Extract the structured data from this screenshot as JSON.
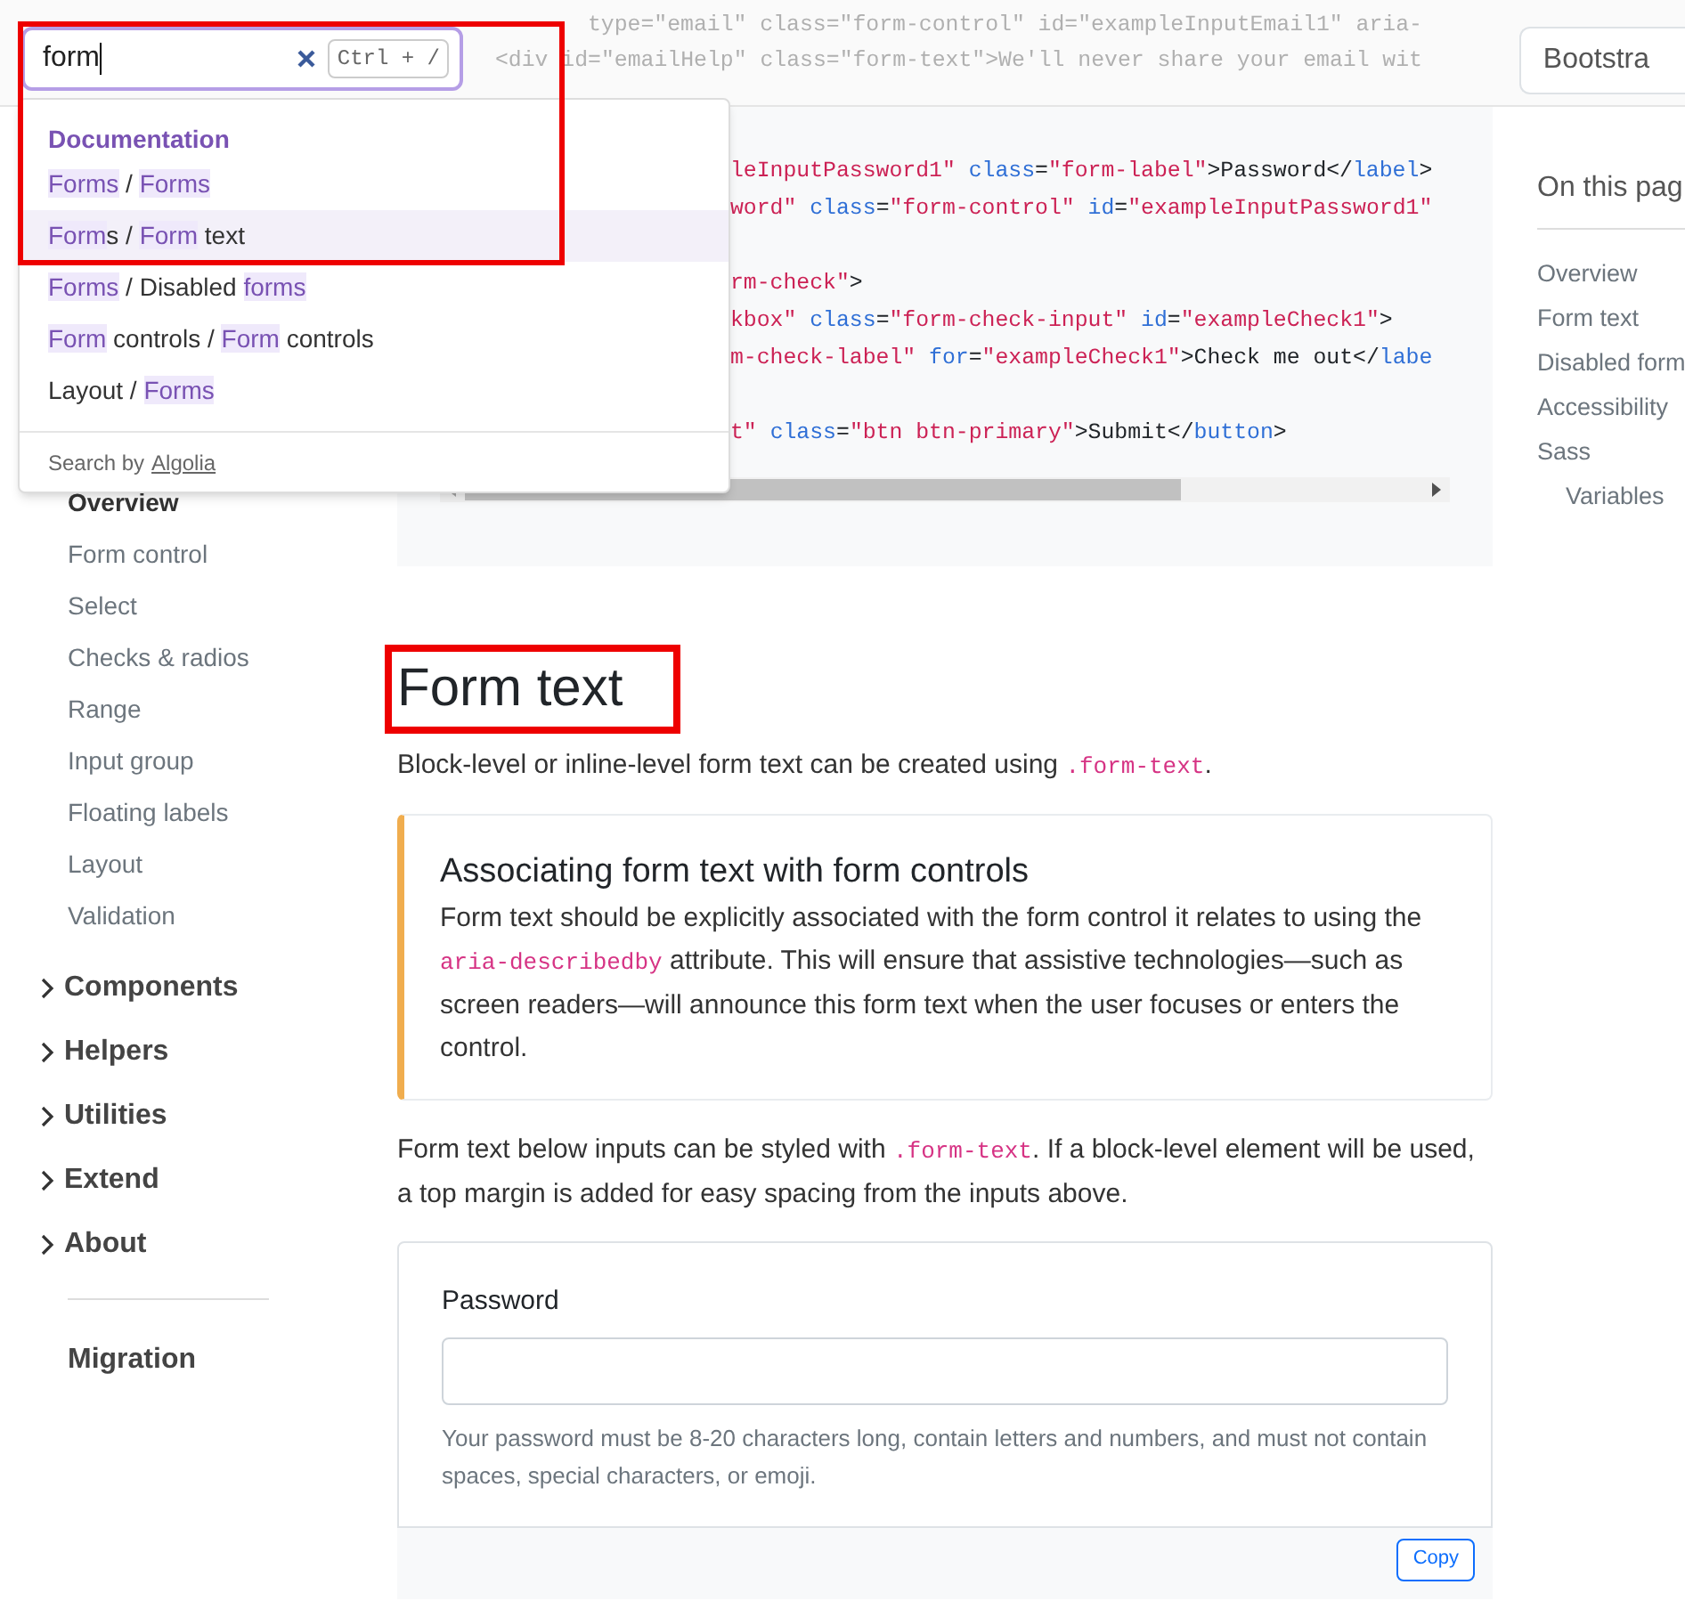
{
  "header": {
    "code_lines": [
      "type=\"email\" class=\"form-control\" id=\"exampleInputEmail1\" aria-",
      "<div id=\"emailHelp\" class=\"form-text\">We'll never share your email wit"
    ],
    "button": "Bootstra"
  },
  "search": {
    "value": "form",
    "shortcut": "Ctrl + /",
    "section": "Documentation",
    "results": [
      {
        "selected": false,
        "segments": [
          {
            "text": "Forms",
            "match": true
          },
          {
            "text": " / ",
            "match": false
          },
          {
            "text": "Forms",
            "match": true
          }
        ]
      },
      {
        "selected": true,
        "segments": [
          {
            "text": "Form",
            "match": true
          },
          {
            "text": "s / ",
            "match": false
          },
          {
            "text": "Form",
            "match": true
          },
          {
            "text": " text",
            "match": false
          }
        ]
      },
      {
        "selected": false,
        "segments": [
          {
            "text": "Forms",
            "match": true
          },
          {
            "text": " / Disabled ",
            "match": false
          },
          {
            "text": "forms",
            "match": true
          }
        ]
      },
      {
        "selected": false,
        "segments": [
          {
            "text": "Form",
            "match": true
          },
          {
            "text": " controls / ",
            "match": false
          },
          {
            "text": "Form",
            "match": true
          },
          {
            "text": " controls",
            "match": false
          }
        ]
      },
      {
        "selected": false,
        "segments": [
          {
            "text": "Layout / ",
            "match": false
          },
          {
            "text": "Forms",
            "match": true
          }
        ]
      }
    ],
    "footer": "Search by",
    "footer_link": "Algolia"
  },
  "sidebar": {
    "items": [
      {
        "label": "Overview",
        "selected": true
      },
      {
        "label": "Form control",
        "selected": false
      },
      {
        "label": "Select",
        "selected": false
      },
      {
        "label": "Checks & radios",
        "selected": false
      },
      {
        "label": "Range",
        "selected": false
      },
      {
        "label": "Input group",
        "selected": false
      },
      {
        "label": "Floating labels",
        "selected": false
      },
      {
        "label": "Layout",
        "selected": false
      },
      {
        "label": "Validation",
        "selected": false
      }
    ],
    "groups": [
      {
        "label": "Components",
        "expanded": false
      },
      {
        "label": "Helpers",
        "expanded": false
      },
      {
        "label": "Utilities",
        "expanded": false
      },
      {
        "label": "Extend",
        "expanded": false
      },
      {
        "label": "About",
        "expanded": false
      }
    ],
    "bottom": "Migration"
  },
  "code_block": {
    "groups": [
      [
        "leInputPassword1\" class=\"form-label\">Password</label>",
        "word\" class=\"form-control\" id=\"exampleInputPassword1\""
      ],
      [
        "rm-check\">",
        "kbox\" class=\"form-check-input\" id=\"exampleCheck1\">",
        "m-check-label\" for=\"exampleCheck1\">Check me out</labe"
      ],
      [
        "t\" class=\"btn btn-primary\">Submit</button>"
      ]
    ]
  },
  "section": {
    "title": "Form text",
    "intro": "Block-level or inline-level form text can be created using",
    "intro_code": ".form-text",
    "intro_end": ".",
    "callout": {
      "title": "Associating form text with form controls",
      "text_before": "Form text should be explicitly associated with the form control it relates to using the",
      "code": "aria-describedby",
      "text_after": "attribute. This will ensure that assistive technologies—such as screen readers—will announce this form text when the user focuses or enters the control."
    },
    "para_before": "Form text below inputs can be styled with",
    "para_code": ".form-text",
    "para_after": ". If a block-level element will be used, a top margin is added for easy spacing from the inputs above.",
    "example": {
      "label": "Password",
      "help": "Your password must be 8-20 characters long, contain letters and numbers, and must not contain spaces, special characters, or emoji."
    },
    "copy_button": "Copy"
  },
  "toc": {
    "title": "On this pag",
    "items": [
      {
        "label": "Overview"
      },
      {
        "label": "Form text"
      },
      {
        "label": "Disabled form"
      },
      {
        "label": "Accessibility"
      },
      {
        "label": "Sass",
        "children": [
          {
            "label": "Variables"
          }
        ]
      }
    ]
  }
}
